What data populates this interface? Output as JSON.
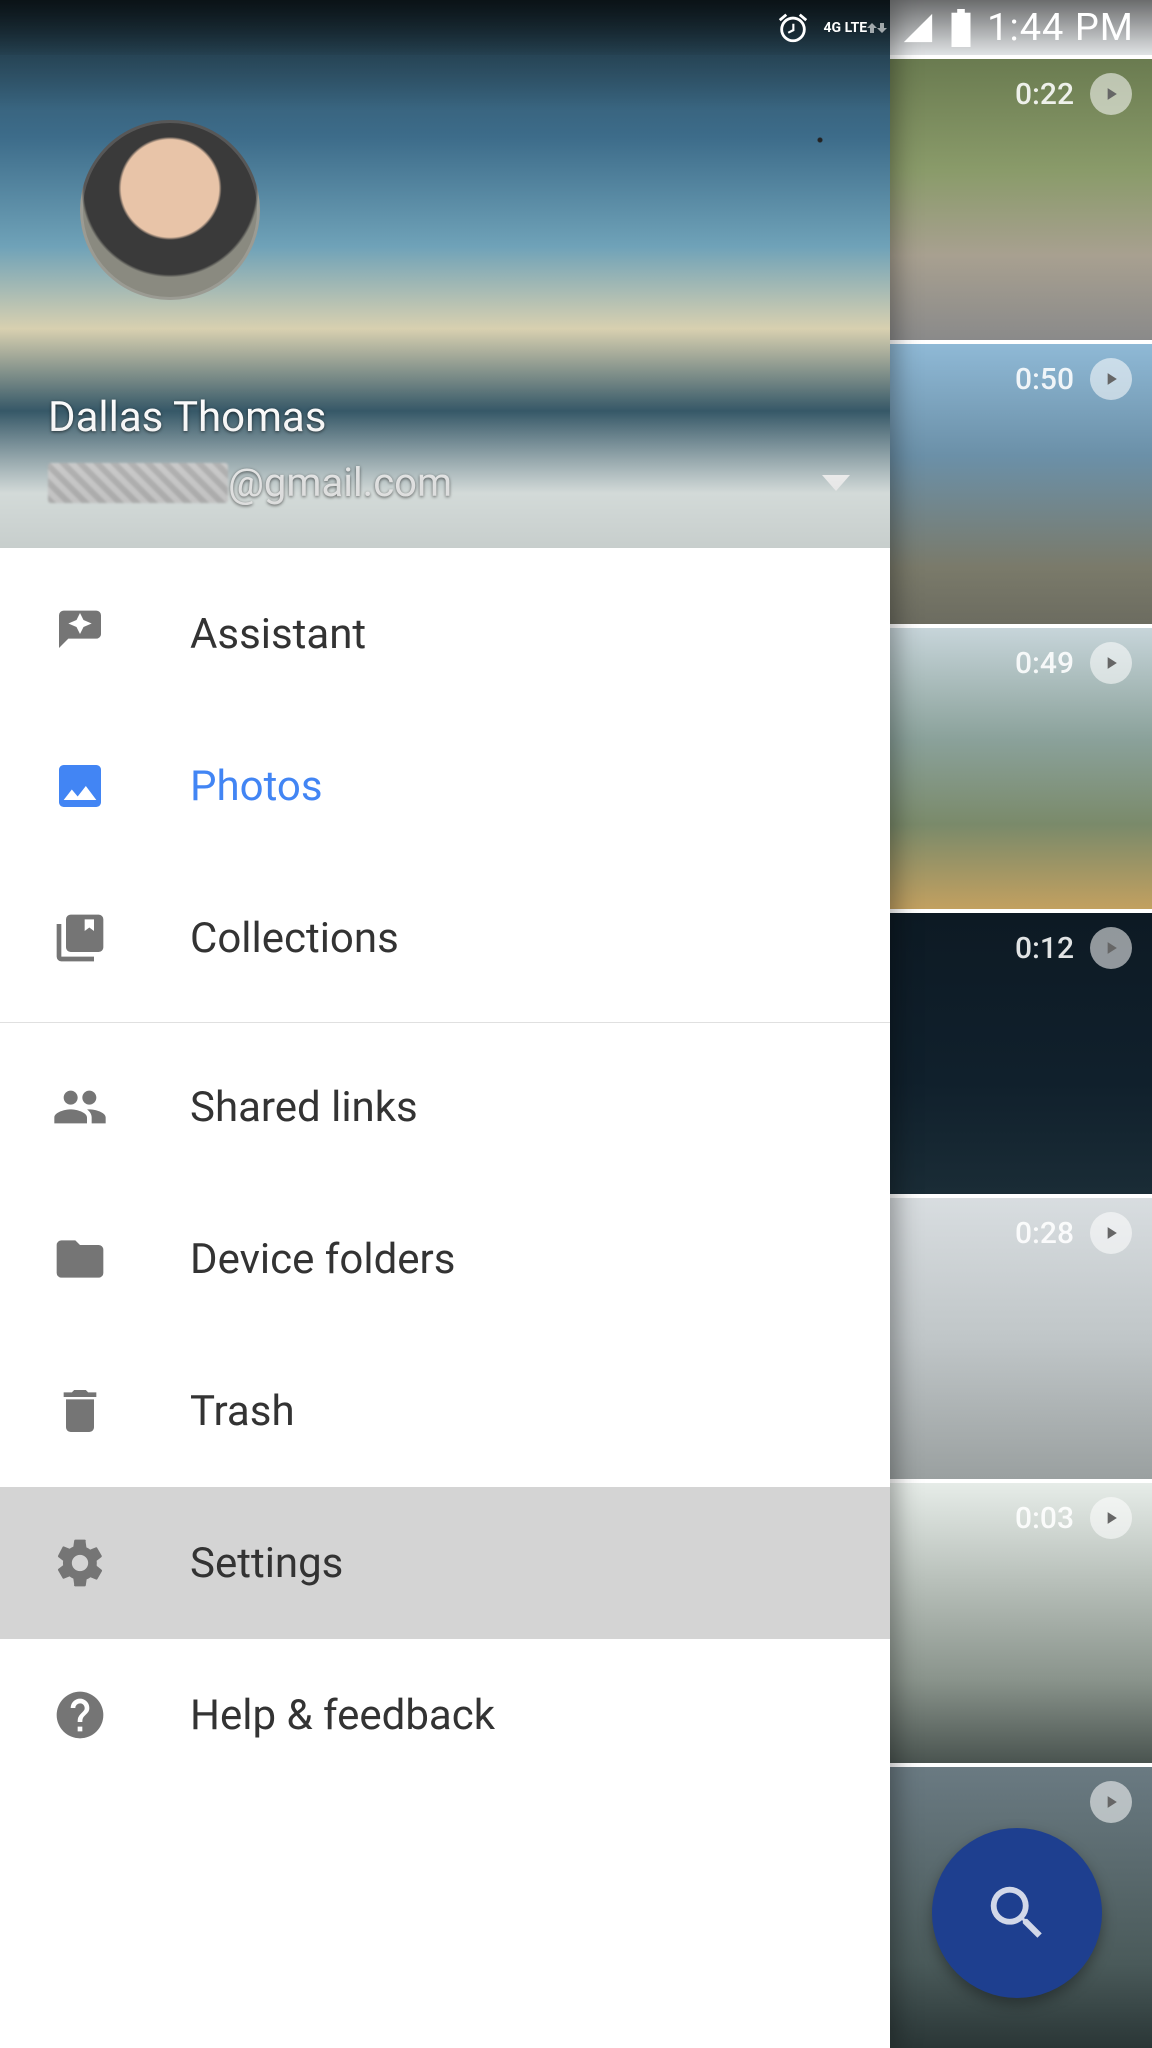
{
  "status_bar": {
    "time": "1:44 PM",
    "network_label": "4G LTE"
  },
  "account": {
    "name": "Dallas Thomas",
    "email_suffix": "@gmail.com"
  },
  "menu": {
    "assistant": "Assistant",
    "photos": "Photos",
    "collections": "Collections",
    "shared_links": "Shared links",
    "device_folders": "Device folders",
    "trash": "Trash",
    "settings": "Settings",
    "help": "Help & feedback"
  },
  "videos": [
    {
      "duration": "0:22"
    },
    {
      "duration": "0:50"
    },
    {
      "duration": "0:49"
    },
    {
      "duration": "0:12"
    },
    {
      "duration": "0:28"
    },
    {
      "duration": "0:03"
    },
    {
      "duration": ""
    }
  ]
}
